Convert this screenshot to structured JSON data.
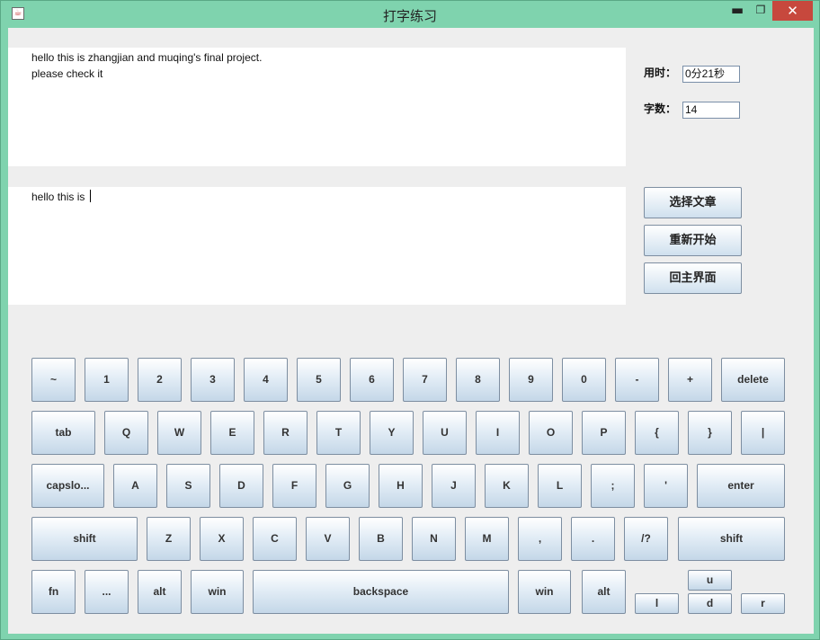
{
  "window": {
    "title": "打字练习",
    "app_icon": "java-icon",
    "controls": {
      "minimize": "▬",
      "maximize": "❐",
      "close": "✕"
    }
  },
  "reference_text": "hello this is zhangjian and muqing's final project.\nplease check it",
  "typed_text": "hello this is ",
  "stats": {
    "time_label": "用时：",
    "time_value": "0分21秒",
    "count_label": "字数：",
    "count_value": "14"
  },
  "buttons": {
    "select_article": "选择文章",
    "restart": "重新开始",
    "main_menu": "回主界面"
  },
  "keyboard": {
    "rows": [
      [
        "~",
        "1",
        "2",
        "3",
        "4",
        "5",
        "6",
        "7",
        "8",
        "9",
        "0",
        "-",
        "+",
        "delete"
      ],
      [
        "tab",
        "Q",
        "W",
        "E",
        "R",
        "T",
        "Y",
        "U",
        "I",
        "O",
        "P",
        "{",
        "}",
        "|"
      ],
      [
        "capslo...",
        "A",
        "S",
        "D",
        "F",
        "G",
        "H",
        "J",
        "K",
        "L",
        ";",
        "'",
        "enter"
      ],
      [
        "shift",
        "Z",
        "X",
        "C",
        "V",
        "B",
        "N",
        "M",
        ",",
        ".",
        "/?",
        "shift"
      ],
      [
        "fn",
        "...",
        "alt",
        "win",
        "backspace",
        "win",
        "alt",
        "u",
        "l",
        "d",
        "r"
      ]
    ]
  }
}
